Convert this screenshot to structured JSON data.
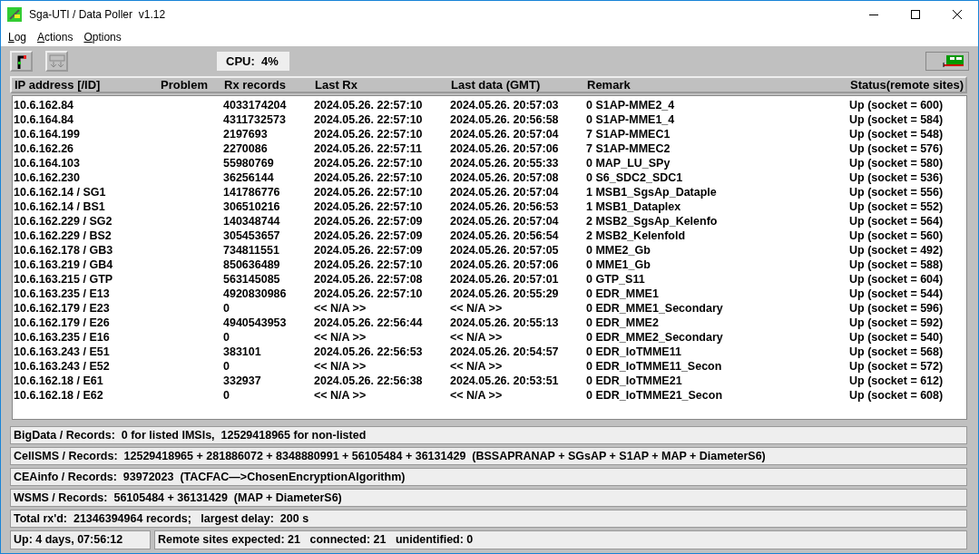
{
  "window": {
    "title": "Sga-UTI / Data Poller  v1.12"
  },
  "menu": [
    "Log",
    "Actions",
    "Options"
  ],
  "toolbar": {
    "cpu": "CPU:  4%"
  },
  "table": {
    "columns": [
      "IP address [/ID]",
      "Problem",
      "Rx records",
      "Last Rx",
      "Last data (GMT)",
      "Remark",
      "Status(remote sites)"
    ],
    "rows": [
      [
        "10.6.162.84",
        "",
        "4033174204",
        "2024.05.26. 22:57:10",
        "2024.05.26. 20:57:03",
        "0 S1AP-MME2_4",
        "Up (socket = 600)"
      ],
      [
        "10.6.164.84",
        "",
        "4311732573",
        "2024.05.26. 22:57:10",
        "2024.05.26. 20:56:58",
        "0 S1AP-MME1_4",
        "Up (socket = 584)"
      ],
      [
        "10.6.164.199",
        "",
        "2197693",
        "2024.05.26. 22:57:10",
        "2024.05.26. 20:57:04",
        "7 S1AP-MMEC1",
        "Up (socket = 548)"
      ],
      [
        "10.6.162.26",
        "",
        "2270086",
        "2024.05.26. 22:57:11",
        "2024.05.26. 20:57:06",
        "7 S1AP-MMEC2",
        "Up (socket = 576)"
      ],
      [
        "10.6.164.103",
        "",
        "55980769",
        "2024.05.26. 22:57:10",
        "2024.05.26. 20:55:33",
        "0 MAP_LU_SPy",
        "Up (socket = 580)"
      ],
      [
        "10.6.162.230",
        "",
        "36256144",
        "2024.05.26. 22:57:10",
        "2024.05.26. 20:57:08",
        "0 S6_SDC2_SDC1",
        "Up (socket = 536)"
      ],
      [
        "10.6.162.14 / SG1",
        "",
        "141786776",
        "2024.05.26. 22:57:10",
        "2024.05.26. 20:57:04",
        "1 MSB1_SgsAp_Dataple",
        "Up (socket = 556)"
      ],
      [
        "10.6.162.14 / BS1",
        "",
        "306510216",
        "2024.05.26. 22:57:10",
        "2024.05.26. 20:56:53",
        "1 MSB1_Dataplex",
        "Up (socket = 552)"
      ],
      [
        "10.6.162.229 / SG2",
        "",
        "140348744",
        "2024.05.26. 22:57:09",
        "2024.05.26. 20:57:04",
        "2 MSB2_SgsAp_Kelenfo",
        "Up (socket = 564)"
      ],
      [
        "10.6.162.229 / BS2",
        "",
        "305453657",
        "2024.05.26. 22:57:09",
        "2024.05.26. 20:56:54",
        "2 MSB2_Kelenfold",
        "Up (socket = 560)"
      ],
      [
        "10.6.162.178 / GB3",
        "",
        "734811551",
        "2024.05.26. 22:57:09",
        "2024.05.26. 20:57:05",
        "0 MME2_Gb",
        "Up (socket = 492)"
      ],
      [
        "10.6.163.219 / GB4",
        "",
        "850636489",
        "2024.05.26. 22:57:10",
        "2024.05.26. 20:57:06",
        "0 MME1_Gb",
        "Up (socket = 588)"
      ],
      [
        "10.6.163.215 / GTP",
        "",
        "563145085",
        "2024.05.26. 22:57:08",
        "2024.05.26. 20:57:01",
        "0 GTP_S11",
        "Up (socket = 604)"
      ],
      [
        "10.6.163.235 / E13",
        "",
        "4920830986",
        "2024.05.26. 22:57:10",
        "2024.05.26. 20:55:29",
        "0 EDR_MME1",
        "Up (socket = 544)"
      ],
      [
        "10.6.162.179 / E23",
        "",
        "0",
        "<< N/A >>",
        "<< N/A >>",
        "0 EDR_MME1_Secondary",
        "Up (socket = 596)"
      ],
      [
        "10.6.162.179 / E26",
        "",
        "4940543953",
        "2024.05.26. 22:56:44",
        "2024.05.26. 20:55:13",
        "0 EDR_MME2",
        "Up (socket = 592)"
      ],
      [
        "10.6.163.235 / E16",
        "",
        "0",
        "<< N/A >>",
        "<< N/A >>",
        "0 EDR_MME2_Secondary",
        "Up (socket = 540)"
      ],
      [
        "10.6.163.243 / E51",
        "",
        "383101",
        "2024.05.26. 22:56:53",
        "2024.05.26. 20:54:57",
        "0 EDR_IoTMME11",
        "Up (socket = 568)"
      ],
      [
        "10.6.163.243 / E52",
        "",
        "0",
        "<< N/A >>",
        "<< N/A >>",
        "0 EDR_IoTMME11_Secon",
        "Up (socket = 572)"
      ],
      [
        "10.6.162.18 / E61",
        "",
        "332937",
        "2024.05.26. 22:56:38",
        "2024.05.26. 20:53:51",
        "0 EDR_IoTMME21",
        "Up (socket = 612)"
      ],
      [
        "10.6.162.18 / E62",
        "",
        "0",
        "<< N/A >>",
        "<< N/A >>",
        "0 EDR_IoTMME21_Secon",
        "Up (socket = 608)"
      ]
    ]
  },
  "info_lines": [
    "BigData / Records:  0 for listed IMSIs,  12529418965 for non-listed",
    "CellSMS / Records:  12529418965 + 281886072 + 8348880991 + 56105484 + 36131429  (BSSAPRANAP + SGsAP + S1AP + MAP + DiameterS6)",
    "CEAinfo / Records:  93972023  (TACFAC—>ChosenEncryptionAlgorithm)",
    "WSMS / Records:  56105484 + 36131429  (MAP + DiameterS6)",
    "Total rx'd:  21346394964 records;   largest delay:  200 s"
  ],
  "status_bar": {
    "uptime": "Up: 4 days, 07:56:12",
    "sites": "Remote sites expected: 21   connected: 21   unidentified: 0"
  }
}
